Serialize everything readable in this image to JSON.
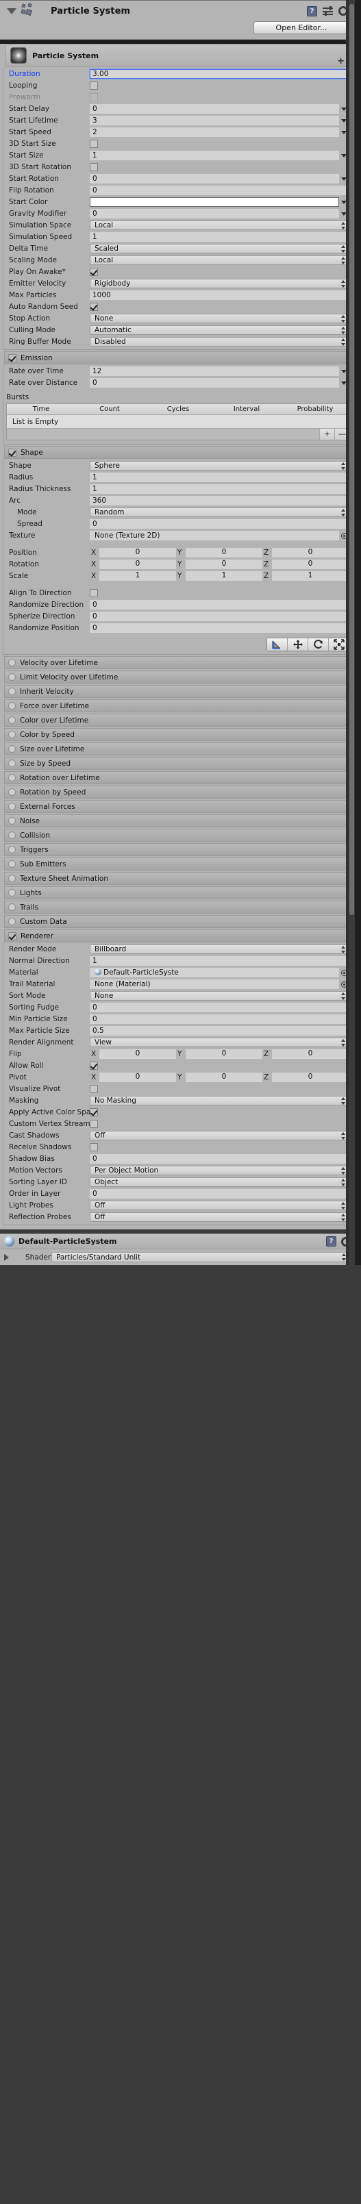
{
  "header": {
    "title": "Particle System",
    "icons": [
      "foldout-triangle",
      "particle-system-icon",
      "help-book-icon",
      "preset-icon",
      "gear-icon"
    ],
    "open_editor_label": "Open Editor..."
  },
  "main_module": {
    "title": "Particle System",
    "plus_label": "+",
    "rows": [
      {
        "label": "Duration",
        "type": "number-focused",
        "value": "3.00"
      },
      {
        "label": "Looping",
        "type": "checkbox",
        "value": false
      },
      {
        "label": "Prewarm",
        "type": "checkbox-disabled",
        "value": false
      },
      {
        "label": "Start Delay",
        "type": "number-curve",
        "value": "0"
      },
      {
        "label": "Start Lifetime",
        "type": "number-curve",
        "value": "3"
      },
      {
        "label": "Start Speed",
        "type": "number-curve",
        "value": "2"
      },
      {
        "label": "3D Start Size",
        "type": "checkbox",
        "value": false
      },
      {
        "label": "Start Size",
        "type": "number-curve",
        "value": "1"
      },
      {
        "label": "3D Start Rotation",
        "type": "checkbox",
        "value": false
      },
      {
        "label": "Start Rotation",
        "type": "number-curve",
        "value": "0"
      },
      {
        "label": "Flip Rotation",
        "type": "number",
        "value": "0"
      },
      {
        "label": "Start Color",
        "type": "color-curve",
        "value": "#ffffff"
      },
      {
        "label": "Gravity Modifier",
        "type": "number-curve",
        "value": "0"
      },
      {
        "label": "Simulation Space",
        "type": "dropdown",
        "value": "Local"
      },
      {
        "label": "Simulation Speed",
        "type": "number",
        "value": "1"
      },
      {
        "label": "Delta Time",
        "type": "dropdown",
        "value": "Scaled"
      },
      {
        "label": "Scaling Mode",
        "type": "dropdown",
        "value": "Local"
      },
      {
        "label": "Play On Awake*",
        "type": "checkbox",
        "value": true
      },
      {
        "label": "Emitter Velocity",
        "type": "dropdown",
        "value": "Rigidbody"
      },
      {
        "label": "Max Particles",
        "type": "number",
        "value": "1000"
      },
      {
        "label": "Auto Random Seed",
        "type": "checkbox",
        "value": true
      },
      {
        "label": "Stop Action",
        "type": "dropdown",
        "value": "None"
      },
      {
        "label": "Culling Mode",
        "type": "dropdown",
        "value": "Automatic"
      },
      {
        "label": "Ring Buffer Mode",
        "type": "dropdown",
        "value": "Disabled"
      }
    ]
  },
  "emission": {
    "title": "Emission",
    "enabled": true,
    "rows": [
      {
        "label": "Rate over Time",
        "type": "number-curve",
        "value": "12"
      },
      {
        "label": "Rate over Distance",
        "type": "number-curve",
        "value": "0"
      }
    ],
    "bursts": {
      "title": "Bursts",
      "columns": [
        "Time",
        "Count",
        "Cycles",
        "Interval",
        "Probability"
      ],
      "empty_text": "List is Empty",
      "add_label": "+",
      "remove_label": "—"
    }
  },
  "shape": {
    "title": "Shape",
    "enabled": true,
    "rows": [
      {
        "label": "Shape",
        "type": "dropdown",
        "value": "Sphere"
      },
      {
        "label": "Radius",
        "type": "number",
        "value": "1"
      },
      {
        "label": "Radius Thickness",
        "type": "number",
        "value": "1"
      },
      {
        "label": "Arc",
        "type": "number",
        "value": "360"
      },
      {
        "label": "Mode",
        "type": "dropdown",
        "value": "Random",
        "indent": true
      },
      {
        "label": "Spread",
        "type": "number",
        "value": "0",
        "indent": true
      },
      {
        "label": "Texture",
        "type": "objectfield",
        "value": "None (Texture 2D)"
      }
    ],
    "transform": [
      {
        "label": "Position",
        "x": "0",
        "y": "0",
        "z": "0"
      },
      {
        "label": "Rotation",
        "x": "0",
        "y": "0",
        "z": "0"
      },
      {
        "label": "Scale",
        "x": "1",
        "y": "1",
        "z": "1"
      }
    ],
    "axis_labels": [
      "X",
      "Y",
      "Z"
    ],
    "rows2": [
      {
        "label": "Align To Direction",
        "type": "checkbox",
        "value": false
      },
      {
        "label": "Randomize Direction",
        "type": "number",
        "value": "0"
      },
      {
        "label": "Spherize Direction",
        "type": "number",
        "value": "0"
      },
      {
        "label": "Randomize Position",
        "type": "number",
        "value": "0"
      }
    ],
    "gizmo_buttons": [
      "gizmo-select-icon",
      "gizmo-move-icon",
      "gizmo-rotate-icon",
      "gizmo-scale-icon"
    ]
  },
  "modules": [
    {
      "label": "Velocity over Lifetime",
      "enabled": false
    },
    {
      "label": "Limit Velocity over Lifetime",
      "enabled": false
    },
    {
      "label": "Inherit Velocity",
      "enabled": false
    },
    {
      "label": "Force over Lifetime",
      "enabled": false
    },
    {
      "label": "Color over Lifetime",
      "enabled": false
    },
    {
      "label": "Color by Speed",
      "enabled": false
    },
    {
      "label": "Size over Lifetime",
      "enabled": false
    },
    {
      "label": "Size by Speed",
      "enabled": false
    },
    {
      "label": "Rotation over Lifetime",
      "enabled": false
    },
    {
      "label": "Rotation by Speed",
      "enabled": false
    },
    {
      "label": "External Forces",
      "enabled": false
    },
    {
      "label": "Noise",
      "enabled": false
    },
    {
      "label": "Collision",
      "enabled": false
    },
    {
      "label": "Triggers",
      "enabled": false
    },
    {
      "label": "Sub Emitters",
      "enabled": false
    },
    {
      "label": "Texture Sheet Animation",
      "enabled": false
    },
    {
      "label": "Lights",
      "enabled": false
    },
    {
      "label": "Trails",
      "enabled": false
    },
    {
      "label": "Custom Data",
      "enabled": false
    }
  ],
  "renderer": {
    "title": "Renderer",
    "enabled": true,
    "rows": [
      {
        "label": "Render Mode",
        "type": "dropdown",
        "value": "Billboard"
      },
      {
        "label": "Normal Direction",
        "type": "number",
        "value": "1"
      },
      {
        "label": "Material",
        "type": "material",
        "value": "Default-ParticleSyste"
      },
      {
        "label": "Trail Material",
        "type": "objectfield",
        "value": "None (Material)"
      },
      {
        "label": "Sort Mode",
        "type": "dropdown",
        "value": "None"
      },
      {
        "label": "Sorting Fudge",
        "type": "number",
        "value": "0"
      },
      {
        "label": "Min Particle Size",
        "type": "number",
        "value": "0"
      },
      {
        "label": "Max Particle Size",
        "type": "number",
        "value": "0.5"
      },
      {
        "label": "Render Alignment",
        "type": "dropdown",
        "value": "View"
      },
      {
        "label": "Flip",
        "type": "vector3",
        "x": "0",
        "y": "0",
        "z": "0"
      },
      {
        "label": "Allow Roll",
        "type": "checkbox",
        "value": true
      },
      {
        "label": "Pivot",
        "type": "vector3",
        "x": "0",
        "y": "0",
        "z": "0"
      },
      {
        "label": "Visualize Pivot",
        "type": "checkbox",
        "value": false
      },
      {
        "label": "Masking",
        "type": "dropdown",
        "value": "No Masking"
      },
      {
        "label": "Apply Active Color Space",
        "type": "checkbox",
        "value": true
      },
      {
        "label": "Custom Vertex Streams",
        "type": "checkbox",
        "value": false
      },
      {
        "label": "Cast Shadows",
        "type": "dropdown",
        "value": "Off"
      },
      {
        "label": "Receive Shadows",
        "type": "checkbox",
        "value": false
      },
      {
        "label": "Shadow Bias",
        "type": "number",
        "value": "0"
      },
      {
        "label": "Motion Vectors",
        "type": "dropdown",
        "value": "Per Object Motion"
      },
      {
        "label": "Sorting Layer ID",
        "type": "dropdown",
        "value": "Object"
      },
      {
        "label": "Order in Layer",
        "type": "number",
        "value": "0"
      },
      {
        "label": "Light Probes",
        "type": "dropdown",
        "value": "Off"
      },
      {
        "label": "Reflection Probes",
        "type": "dropdown",
        "value": "Off"
      }
    ],
    "axis_labels": [
      "X",
      "Y",
      "Z"
    ]
  },
  "material_footer": {
    "title": "Default-ParticleSystem",
    "shader_label": "Shader",
    "shader_value": "Particles/Standard Unlit",
    "icons": [
      "help-book-icon",
      "gear-icon"
    ]
  }
}
